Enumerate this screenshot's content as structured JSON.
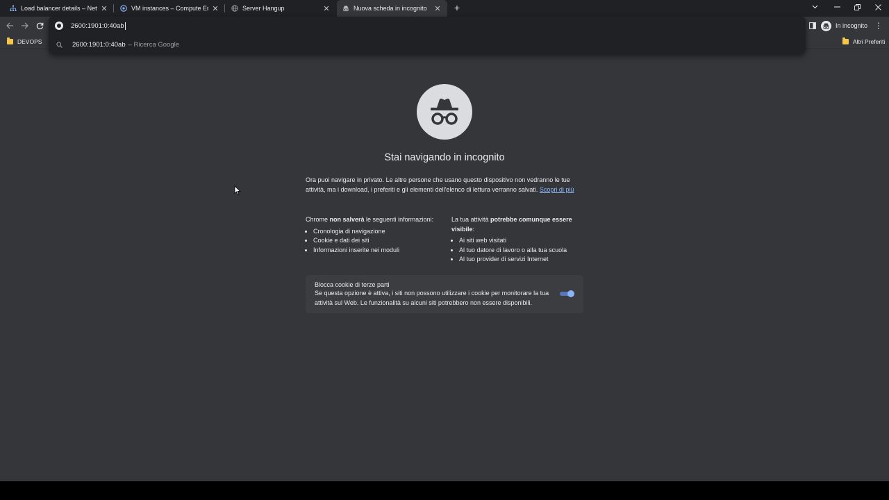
{
  "tabs": [
    {
      "title": "Load balancer details – Network",
      "icon": "network-icon",
      "active": false
    },
    {
      "title": "VM instances – Compute Engine",
      "icon": "compute-engine-icon",
      "active": false
    },
    {
      "title": "Server Hangup",
      "icon": "globe-icon",
      "active": false
    },
    {
      "title": "Nuova scheda in incognito",
      "icon": "incognito-icon",
      "active": true
    }
  ],
  "omnibox": {
    "value": "2600:1901:0:40ab",
    "suggestion": {
      "text": "2600:1901:0:40ab",
      "sub": "– Ricerca Google"
    }
  },
  "toolbar": {
    "incognito_label": "In incognito"
  },
  "bookmarks": {
    "devops": "DEVOPS",
    "other": "Altri Preferiti"
  },
  "page": {
    "heading": "Stai navigando in incognito",
    "intro": "Ora puoi navigare in privato. Le altre persone che usano questo dispositivo non vedranno le tue attività, ma i download, i preferiti e gli elementi dell'elenco di lettura verranno salvati.",
    "learn_more": "Scopri di più",
    "left_col": {
      "pre": "Chrome ",
      "bold": "non salverà",
      "post": " le seguenti informazioni:",
      "items": [
        "Cronologia di navigazione",
        "Cookie e dati dei siti",
        "Informazioni inserite nei moduli"
      ]
    },
    "right_col": {
      "pre": "La tua attività ",
      "bold": "potrebbe comunque essere visibile",
      "post": ":",
      "items": [
        "Ai siti web visitati",
        "Al tuo datore di lavoro o alla tua scuola",
        "Al tuo provider di servizi Internet"
      ]
    },
    "cookie_card": {
      "title": "Blocca cookie di terze parti",
      "desc": "Se questa opzione è attiva, i siti non possono utilizzare i cookie per monitorare la tua attività sul Web. Le funzionalità su alcuni siti potrebbero non essere disponibili.",
      "enabled": true
    }
  },
  "colors": {
    "accent": "#8ab4f8",
    "background": "#35363a",
    "tabstrip": "#202124",
    "folder": "#f4c64e"
  }
}
